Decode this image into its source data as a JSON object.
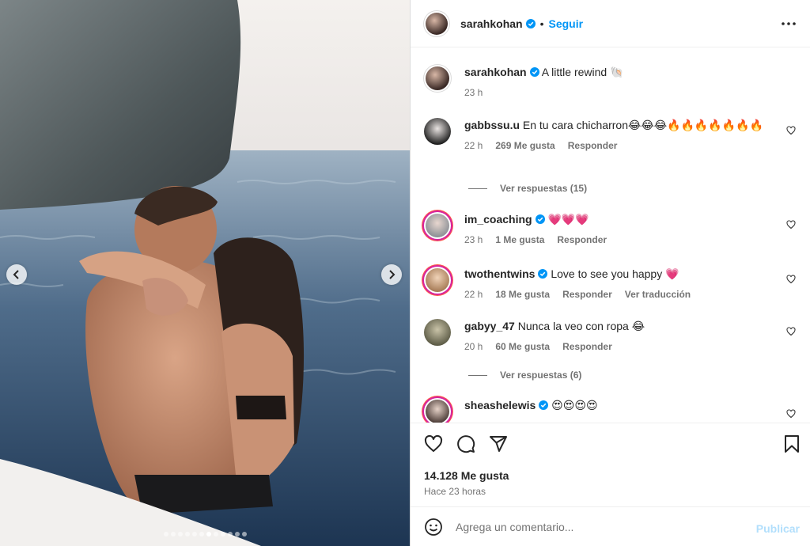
{
  "post": {
    "username": "sarahkohan",
    "follow_label": "Seguir",
    "dot": "•",
    "caption_text": "A little rewind 🐚",
    "caption_time": "23 h",
    "likes": "14.128 Me gusta",
    "posted_ago": "Hace 23 horas",
    "carousel": {
      "total_slides": 12,
      "active_slide": 6
    }
  },
  "comments": [
    {
      "user": "gabbssu.u",
      "text": "En tu cara chicharron😂😂😂🔥🔥🔥🔥🔥🔥🔥",
      "time": "22 h",
      "likes": "269 Me gusta",
      "reply": "Responder",
      "verified": false,
      "view_replies": "Ver respuestas (15)"
    },
    {
      "user": "im_coaching",
      "text": "💗💗💗",
      "time": "23 h",
      "likes": "1 Me gusta",
      "reply": "Responder",
      "verified": true
    },
    {
      "user": "twothentwins",
      "text": "Love to see you happy 💗",
      "time": "22 h",
      "likes": "18 Me gusta",
      "reply": "Responder",
      "translate": "Ver traducción",
      "verified": true
    },
    {
      "user": "gabyy_47",
      "text": "Nunca la veo con ropa 😂",
      "time": "20 h",
      "likes": "60 Me gusta",
      "reply": "Responder",
      "verified": false,
      "view_replies": "Ver respuestas (6)"
    },
    {
      "user": "sheashelewis",
      "text": "😍😍😍😍",
      "verified": true
    }
  ],
  "add_comment": {
    "placeholder": "Agrega un comentario...",
    "publish_label": "Publicar"
  },
  "colors": {
    "accent": "#0095f6",
    "verified": "#0095f6",
    "publish_disabled": "#b2dffc",
    "meta_text": "#737373"
  },
  "icons": [
    "chevron-left-icon",
    "chevron-right-icon",
    "verified-icon",
    "more-icon",
    "heart-icon",
    "comment-icon",
    "share-icon",
    "bookmark-icon",
    "emoji-icon"
  ]
}
